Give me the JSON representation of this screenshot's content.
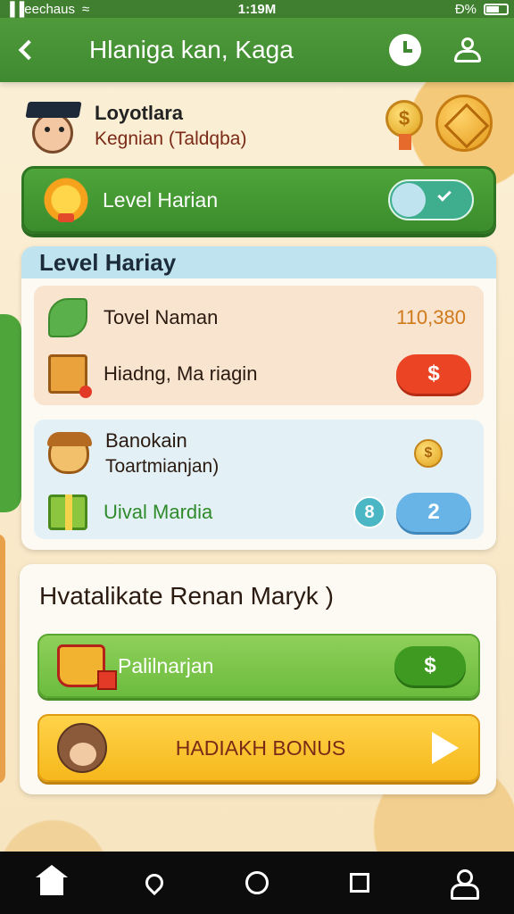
{
  "status_bar": {
    "carrier": "▐▐eechaus",
    "time": "1:19M",
    "battery": "Đ%"
  },
  "header": {
    "title": "Hlaniga kan, Kaga"
  },
  "profile": {
    "name": "Loyotlara",
    "subtitle": "Kegnian (Taldqba)",
    "medal_symbol": "$"
  },
  "level_toggle": {
    "label": "Level Harian",
    "enabled": true
  },
  "level_panel": {
    "title": "Level Hariay",
    "rows": [
      {
        "label": "Tovel Naman",
        "value": "110,380"
      },
      {
        "label": "Hiadng, Ma riagin",
        "button": "$"
      }
    ],
    "info": {
      "title": "Banokain",
      "subtitle": "Toartmianjan)",
      "coin_symbol": "$"
    },
    "reward_row": {
      "label": "Uival Mardia",
      "badge": "8",
      "button": "2"
    }
  },
  "bonus_panel": {
    "title": "Hvatalikate Renan Maryk )",
    "green_action": {
      "label": "Palilnarjan",
      "button": "$"
    },
    "yellow_action": {
      "label": "HADIAKH BONUS"
    }
  },
  "colors": {
    "header_green": "#3f8a30",
    "accent_green": "#4ea53a",
    "panel_head_blue": "#bfe3ef",
    "button_red": "#ea4424",
    "button_blue": "#69b4e6",
    "bonus_yellow": "#f6b81c",
    "value_orange": "#d07a1c"
  },
  "icons": {
    "status": [
      "wifi-icon",
      "battery-icon"
    ],
    "header": [
      "back-icon",
      "clock-icon",
      "user-icon"
    ],
    "nav": [
      "home-icon",
      "location-icon",
      "circle-icon",
      "square-icon",
      "profile-icon"
    ]
  }
}
